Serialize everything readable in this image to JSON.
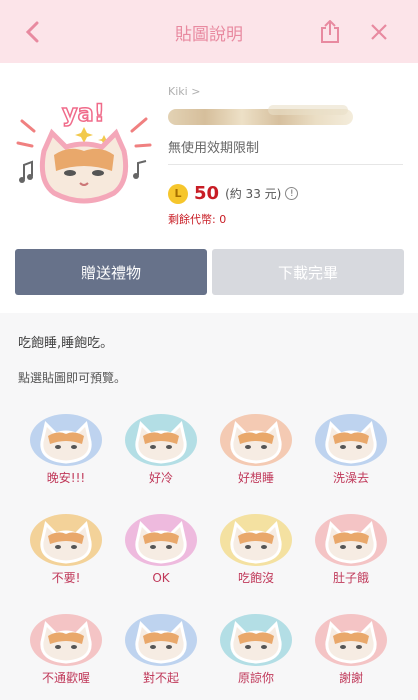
{
  "header": {
    "title": "貼圖說明",
    "back_icon": "chevron-left-icon",
    "share_icon": "share-icon",
    "close_icon": "close-icon",
    "bg_color": "#fce4e9",
    "title_color": "#e88aa0"
  },
  "package": {
    "author": "Kiki >",
    "validity": "無使用效期限制",
    "coin_symbol": "L",
    "price": "50",
    "price_note": "(約 33 元)",
    "balance_label": "剩餘代幣",
    "balance_value": ": 0",
    "preview_caption": "ya!"
  },
  "buttons": {
    "gift": "贈送禮物",
    "download": "下載完畢"
  },
  "description": "吃飽睡,睡飽吃。",
  "hint": "點選貼圖即可預覽。",
  "stickers": [
    {
      "caption": "晚安!!!",
      "bubble": "#8fb7e8"
    },
    {
      "caption": "好冷",
      "bubble": "#7ccad6"
    },
    {
      "caption": "好想睡",
      "bubble": "#f2a67a"
    },
    {
      "caption": "洗澡去",
      "bubble": "#8fb7e8"
    },
    {
      "caption": "不要!",
      "bubble": "#f0b54a"
    },
    {
      "caption": "OK",
      "bubble": "#e889c8"
    },
    {
      "caption": "吃飽沒",
      "bubble": "#f3d05a"
    },
    {
      "caption": "肚子餓",
      "bubble": "#f29a9a"
    },
    {
      "caption": "不通歡喔",
      "bubble": "#f29a9a"
    },
    {
      "caption": "對不起",
      "bubble": "#8fb7e8"
    },
    {
      "caption": "原諒你",
      "bubble": "#7ccad6"
    },
    {
      "caption": "謝謝",
      "bubble": "#f29a9a"
    }
  ],
  "colors": {
    "gift_button": "#67728a",
    "download_button": "#d7d9de",
    "price": "#c81d25",
    "coin": "#f6c62c"
  }
}
